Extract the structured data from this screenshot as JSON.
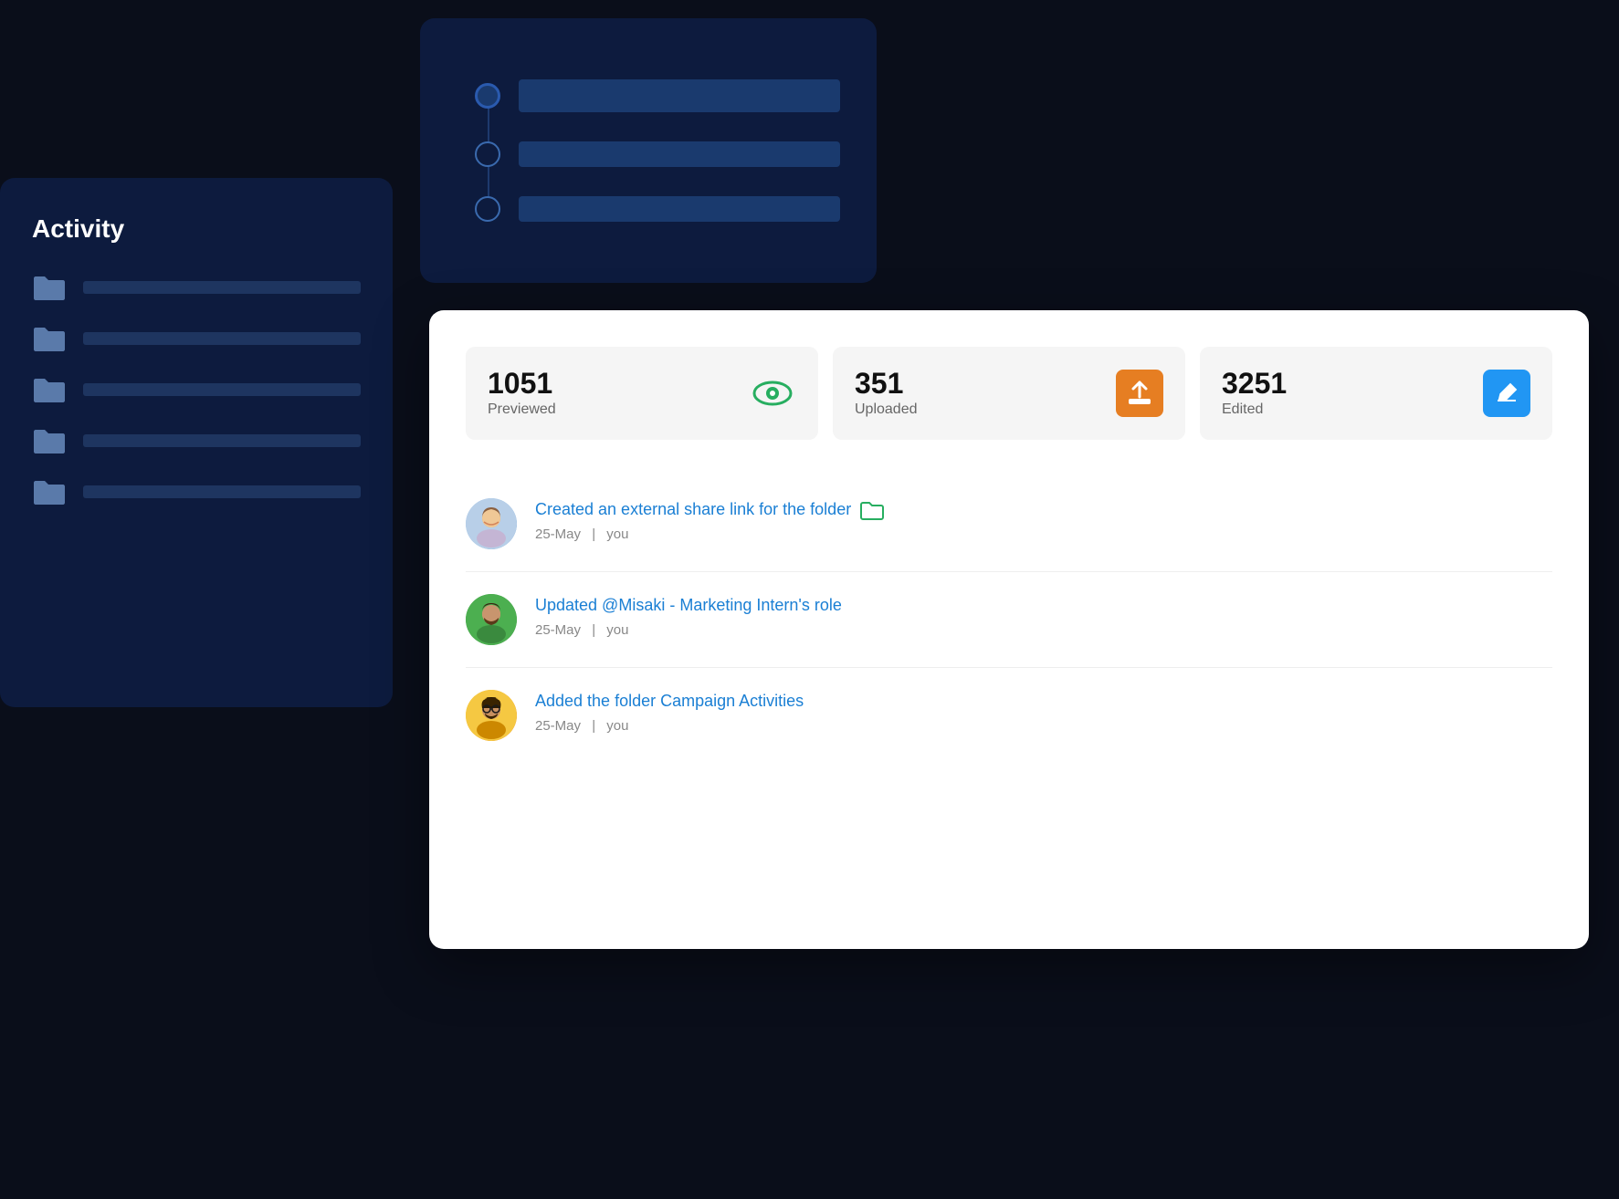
{
  "topPanel": {
    "rows": [
      {
        "dotType": "filled"
      },
      {
        "dotType": "outline"
      },
      {
        "dotType": "outline"
      }
    ]
  },
  "activityPanel": {
    "title": "Activity",
    "folders": [
      {
        "barClass": "w1"
      },
      {
        "barClass": "w2"
      },
      {
        "barClass": "w3"
      },
      {
        "barClass": "w4"
      },
      {
        "barClass": "w5"
      }
    ]
  },
  "stats": [
    {
      "number": "1051",
      "label": "Previewed",
      "iconType": "green"
    },
    {
      "number": "351",
      "label": "Uploaded",
      "iconType": "orange"
    },
    {
      "number": "3251",
      "label": "Edited",
      "iconType": "blue"
    }
  ],
  "activities": [
    {
      "action": "Created an external share link for the folder",
      "date": "25-May",
      "who": "you",
      "iconType": "folder",
      "avatarClass": "avatar-1"
    },
    {
      "action": "Updated @Misaki - Marketing Intern's role",
      "date": "25-May",
      "who": "you",
      "iconType": "none",
      "avatarClass": "avatar-2"
    },
    {
      "action": "Added the folder Campaign Activities",
      "date": "25-May",
      "who": "you",
      "iconType": "none",
      "avatarClass": "avatar-3"
    }
  ],
  "labels": {
    "separator": "|"
  }
}
